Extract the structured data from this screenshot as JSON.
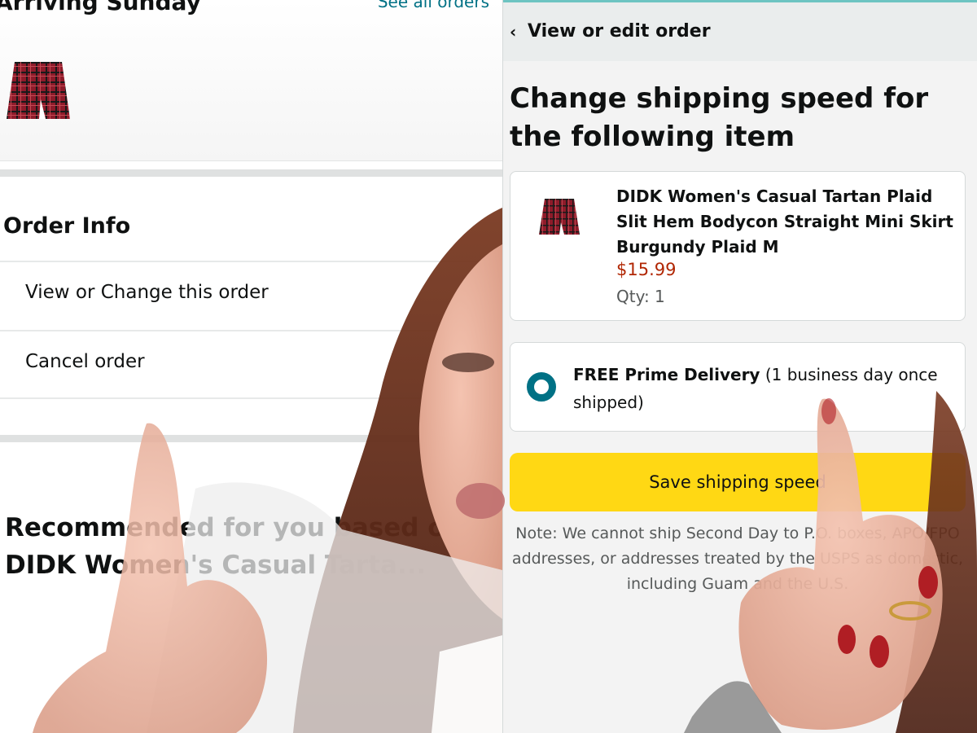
{
  "left": {
    "arriving_title": "Arriving Sunday",
    "see_all_orders": "See all orders",
    "order_info_title": "Order Info",
    "menu_items": [
      {
        "label": "View or Change this order"
      },
      {
        "label": "Cancel order"
      }
    ],
    "recommendations_text": "Recommended for you based on DIDK Women's Casual Tarta..."
  },
  "right": {
    "back_label": "View or edit order",
    "page_title": "Change shipping speed for the following item",
    "item": {
      "name": "DIDK Women's Casual Tartan Plaid Slit Hem Bodycon Straight Mini Skirt Burgundy Plaid M",
      "price": "$15.99",
      "qty": "Qty: 1"
    },
    "delivery_option": {
      "bold_label": "FREE Prime Delivery",
      "detail": " (1 business day once shipped)"
    },
    "save_button_label": "Save shipping speed",
    "note": "Note: We cannot ship Second Day to P.O. boxes, APO/FPO addresses, or addresses treated by the USPS as domestic, including Guam and the U.S."
  },
  "colors": {
    "link_teal": "#007185",
    "price_red": "#b12704",
    "button_yellow": "#ffd814",
    "accent_bar": "#6dc4c2"
  }
}
